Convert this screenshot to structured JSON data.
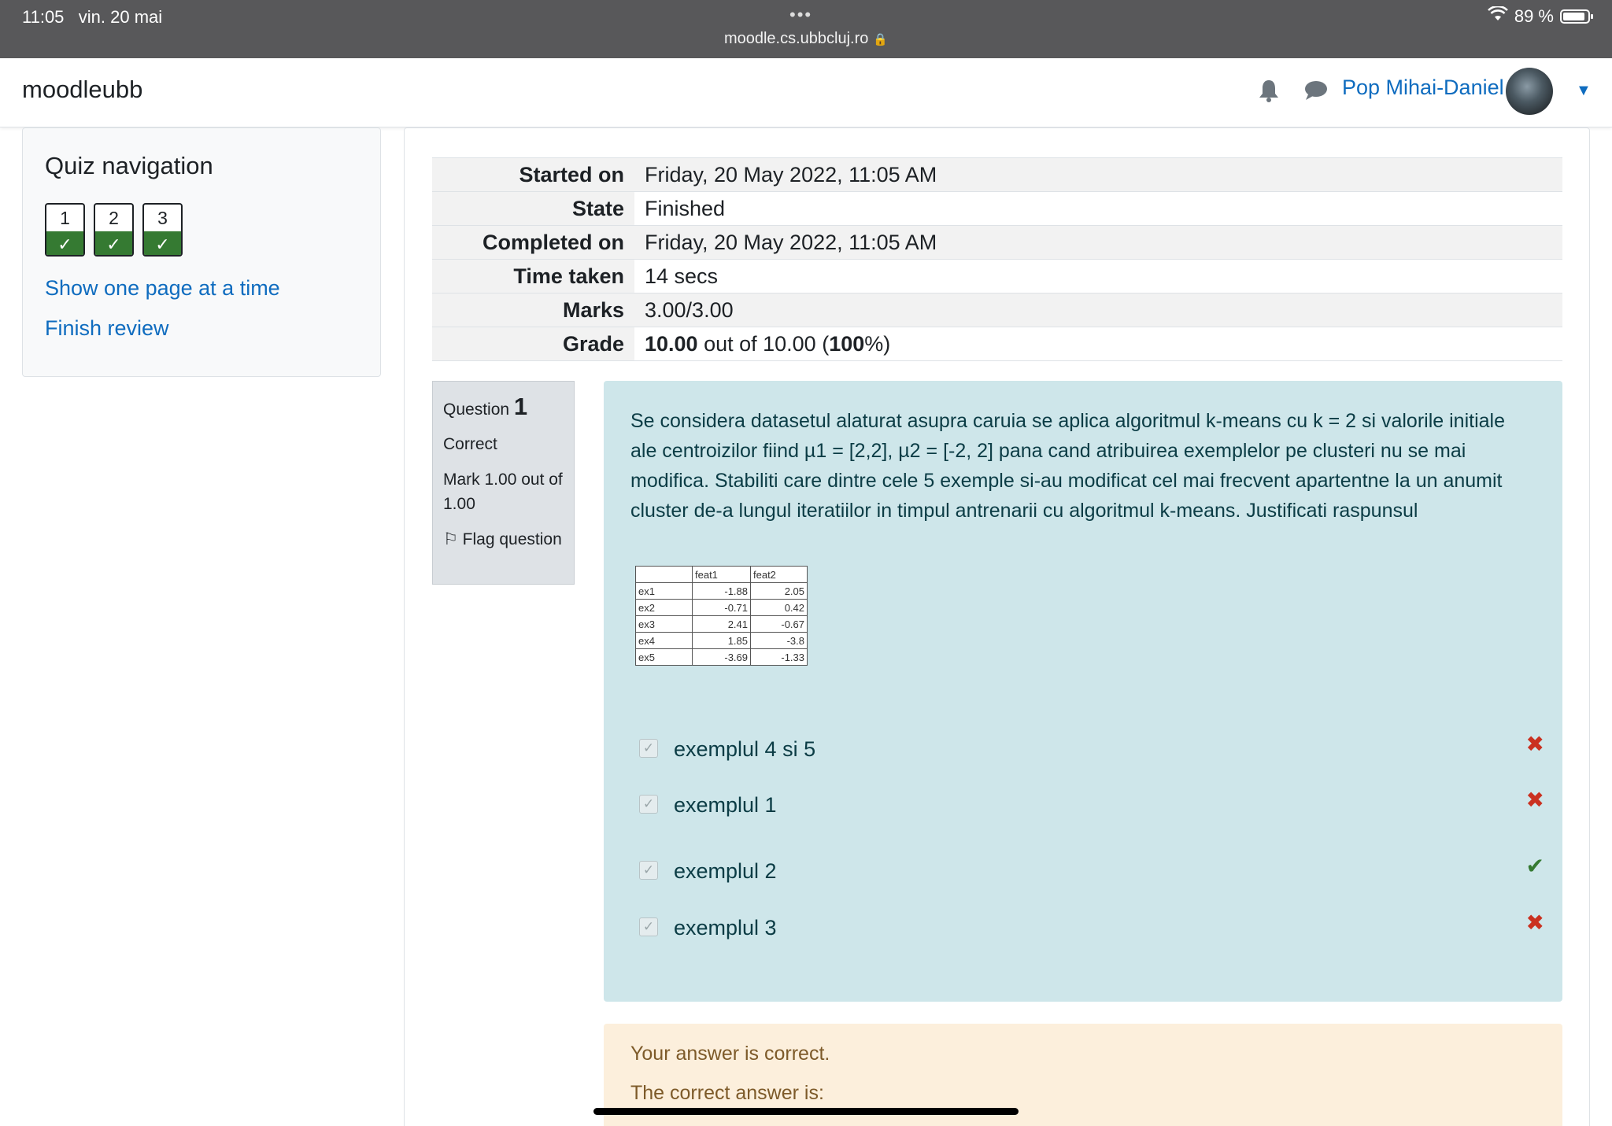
{
  "status_bar": {
    "time": "11:05",
    "date": "vin. 20 mai",
    "url": "moodle.cs.ubbcluj.ro",
    "battery": "89 %",
    "dots": "•••"
  },
  "header": {
    "brand": "moodleubb",
    "user_name": "Pop Mihai-Daniel",
    "bell_icon": "🔔",
    "chat_icon": "💬",
    "caret": "▼"
  },
  "quiz_nav": {
    "title": "Quiz navigation",
    "buttons": [
      {
        "num": "1",
        "state": "✓"
      },
      {
        "num": "2",
        "state": "✓"
      },
      {
        "num": "3",
        "state": "✓"
      }
    ],
    "show_one_page": "Show one page at a time",
    "finish_review": "Finish review"
  },
  "summary": [
    {
      "label": "Started on",
      "value": "Friday, 20 May 2022, 11:05 AM"
    },
    {
      "label": "State",
      "value": "Finished"
    },
    {
      "label": "Completed on",
      "value": "Friday, 20 May 2022, 11:05 AM"
    },
    {
      "label": "Time taken",
      "value": "14 secs"
    },
    {
      "label": "Marks",
      "value": "3.00/3.00"
    },
    {
      "label": "Grade",
      "grade_value": "10.00",
      "grade_mid": " out of 10.00 (",
      "grade_pct": "100",
      "grade_end": "%)"
    }
  ],
  "question": {
    "prefix": "Question",
    "number": "1",
    "status": "Correct",
    "mark": "Mark 1.00 out of 1.00",
    "flag": "Flag question",
    "flag_icon": "⚐",
    "text": "Se considera datasetul alaturat asupra caruia se aplica algoritmul k-means cu k = 2 si valorile initiale ale centroizilor fiind µ1 = [2,2], µ2 = [-2, 2] pana cand atribuirea exemplelor pe clusteri nu se mai modifica. Stabiliti care dintre cele 5 exemple si-au modificat cel mai frecvent apartentne la un anumit cluster de-a lungul iteratiilor in timpul antrenarii cu algoritmul k-means. Justificati raspunsul",
    "table": {
      "headers": [
        "",
        "feat1",
        "feat2"
      ],
      "rows": [
        [
          "ex1",
          "-1.88",
          "2.05"
        ],
        [
          "ex2",
          "-0.71",
          "0.42"
        ],
        [
          "ex3",
          "2.41",
          "-0.67"
        ],
        [
          "ex4",
          "1.85",
          "-3.8"
        ],
        [
          "ex5",
          "-3.69",
          "-1.33"
        ]
      ]
    },
    "answers": [
      {
        "label": "exemplul 4 si 5",
        "checkbox": "✓",
        "mark": "✖"
      },
      {
        "label": "exemplul 1",
        "checkbox": "✓",
        "mark": "✖"
      },
      {
        "label": "exemplul 2",
        "checkbox": "✓",
        "mark": "✔"
      },
      {
        "label": "exemplul 3",
        "checkbox": "✓",
        "mark": "✖"
      }
    ]
  },
  "outcome": {
    "line1": "Your answer is correct.",
    "line2": "The correct answer is:"
  }
}
